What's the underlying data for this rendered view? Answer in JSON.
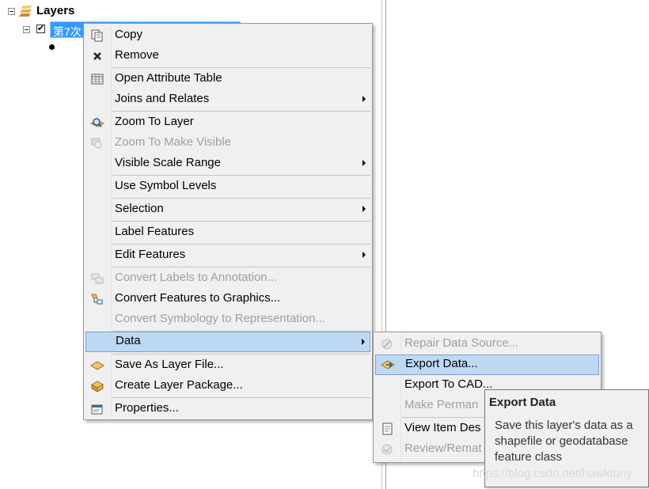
{
  "toc": {
    "root_label": "Layers",
    "layer_name": "第7次",
    "layer_checked": "✔"
  },
  "context_menu": {
    "items": [
      {
        "label": "Copy"
      },
      {
        "label": "Remove"
      },
      {
        "label": "Open Attribute Table"
      },
      {
        "label": "Joins and Relates"
      },
      {
        "label": "Zoom To Layer"
      },
      {
        "label": "Zoom To Make Visible"
      },
      {
        "label": "Visible Scale Range"
      },
      {
        "label": "Use Symbol Levels"
      },
      {
        "label": "Selection"
      },
      {
        "label": "Label Features"
      },
      {
        "label": "Edit Features"
      },
      {
        "label": "Convert Labels to Annotation..."
      },
      {
        "label": "Convert Features to Graphics..."
      },
      {
        "label": "Convert Symbology to Representation..."
      },
      {
        "label": "Data"
      },
      {
        "label": "Save As Layer File..."
      },
      {
        "label": "Create Layer Package..."
      },
      {
        "label": "Properties..."
      }
    ]
  },
  "data_submenu": {
    "items": [
      {
        "label": "Repair Data Source..."
      },
      {
        "label": "Export Data..."
      },
      {
        "label": "Export To CAD..."
      },
      {
        "label": "Make Perman"
      },
      {
        "label": "View Item Des"
      },
      {
        "label": "Review/Remat"
      }
    ]
  },
  "tooltip": {
    "title": "Export Data",
    "body": "Save this layer's data as a shapefile or geodatabase feature class"
  },
  "watermark": "https://blog.csdn.net/hawktony",
  "colors": {
    "selection": "#3399ff",
    "menu_bg": "#f0f0f0",
    "highlight": "#bed9f4",
    "disabled_text": "#a0a0a0"
  }
}
